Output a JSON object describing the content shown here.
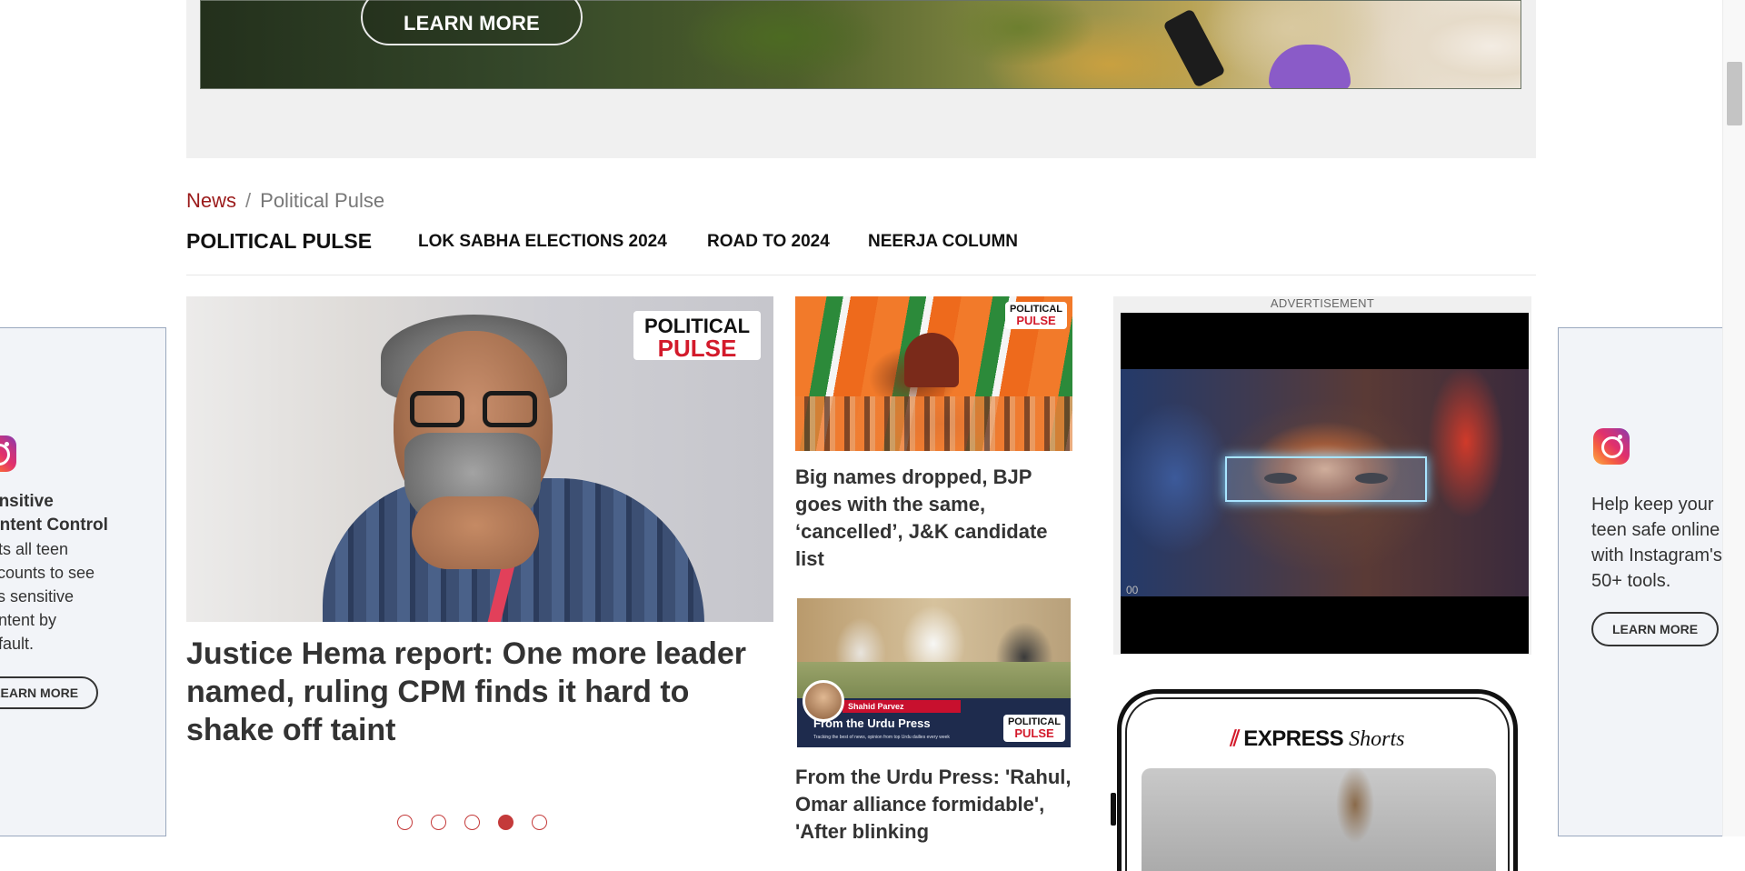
{
  "top_ad": {
    "button_label": "LEARN MORE"
  },
  "breadcrumb": {
    "items": [
      "News",
      "Political Pulse"
    ],
    "separator": "/"
  },
  "section_nav": {
    "title": "POLITICAL PULSE",
    "links": [
      "LOK SABHA ELECTIONS 2024",
      "ROAD TO 2024",
      "NEERJA COLUMN"
    ]
  },
  "left_side_ad": {
    "title_lines": [
      "ensitive",
      "ontent Control"
    ],
    "body_lines": [
      "ets all teen",
      "ccounts to see",
      "ss sensitive",
      "ontent by",
      "efault."
    ],
    "button_label": "LEARN MORE",
    "icon": "instagram-icon"
  },
  "right_side_ad": {
    "body_lines": [
      "Help keep your",
      "teen safe online",
      "with Instagram's",
      "50+ tools."
    ],
    "button_label": "LEARN MORE",
    "icon": "instagram-icon"
  },
  "lead_story": {
    "logo_line1": "POLITICAL",
    "logo_line2": "PULSE",
    "headline": "Justice Hema report: One more leader named, ruling CPM finds it hard to shake off taint"
  },
  "carousel": {
    "total": 5,
    "active_index": 3
  },
  "stories": [
    {
      "logo_line1": "POLITICAL",
      "logo_line2": "PULSE",
      "headline": "Big names dropped, BJP goes with the same, ‘cancelled’, J&K candidate list"
    },
    {
      "badge": "Shahid Parvez",
      "image_title": "From the Urdu Press",
      "image_subtitle": "Tracking the best of news, opinion from top Urdu dailies every week",
      "logo_line1": "POLITICAL",
      "logo_line2": "PULSE",
      "headline": "From the Urdu Press: 'Rahul, Omar alliance formidable', 'After blinking"
    }
  ],
  "video_ad": {
    "label": "ADVERTISEMENT",
    "time": "00"
  },
  "express_shorts": {
    "brand": "EXPRESS",
    "product": "Shorts"
  },
  "colors": {
    "accent_red": "#c43a3a",
    "breadcrumb_link": "#9b1b1b"
  }
}
